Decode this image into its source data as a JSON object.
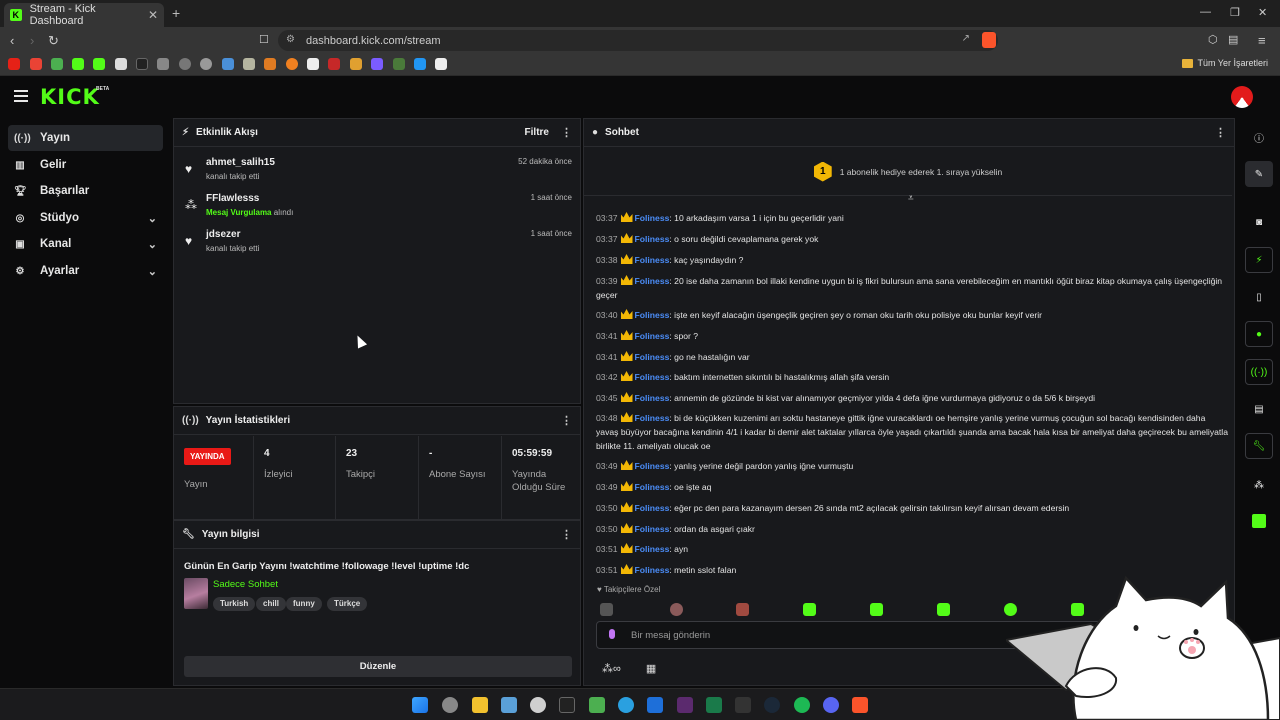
{
  "browser": {
    "tab_title": "Stream - Kick Dashboard",
    "url": "dashboard.kick.com/stream",
    "bookmarks_all": "Tüm Yer İşaretleri"
  },
  "app": {
    "logo": "KICK",
    "beta": "BETA",
    "accent": "#53fc18"
  },
  "sidebar": {
    "items": [
      {
        "label": "Yayın",
        "icon": "broadcast-icon",
        "active": true
      },
      {
        "label": "Gelir",
        "icon": "chart-icon"
      },
      {
        "label": "Başarılar",
        "icon": "trophy-icon"
      },
      {
        "label": "Stüdyo",
        "icon": "studio-icon",
        "expandable": true
      },
      {
        "label": "Kanal",
        "icon": "channel-icon",
        "expandable": true
      },
      {
        "label": "Ayarlar",
        "icon": "gear-icon",
        "expandable": true
      }
    ]
  },
  "activity": {
    "title": "Etkinlik Akışı",
    "filter": "Filtre",
    "events": [
      {
        "name": "ahmet_salih15",
        "sub": "kanalı takip etti",
        "time": "52 dakika önce",
        "icon": "heart-icon"
      },
      {
        "name": "FFlawlesss",
        "sub_highlight": "Mesaj Vurgulama",
        "sub_rest": " alındı",
        "time": "1 saat önce",
        "icon": "kicks-icon"
      },
      {
        "name": "jdsezer",
        "sub": "kanalı takip etti",
        "time": "1 saat önce",
        "icon": "heart-icon"
      }
    ]
  },
  "stats": {
    "title": "Yayın İstatistikleri",
    "live_badge": "YAYINDA",
    "live_label": "Yayın",
    "cells": [
      {
        "value": "4",
        "label": "İzleyici"
      },
      {
        "value": "23",
        "label": "Takipçi"
      },
      {
        "value": "-",
        "label": "Abone Sayısı"
      },
      {
        "value": "05:59:59",
        "label": "Yayında Olduğu Süre"
      }
    ]
  },
  "stream_info": {
    "title": "Yayın bilgisi",
    "stream_title": "Günün En Garip Yayını !watchtime !followage !level !uptime !dc",
    "category": "Sadece Sohbet",
    "tags": [
      "Turkish",
      "chill",
      "funny",
      "Türkçe"
    ],
    "edit": "Düzenle"
  },
  "chat": {
    "title": "Sohbet",
    "promo_num": "1",
    "promo_text": "1 abonelik hediye ederek 1. sıraya yükselin",
    "messages": [
      {
        "time": "03:37",
        "user": "Foliness",
        "text": ": 10 arkadaşım varsa 1 i için bu geçerlidir yani"
      },
      {
        "time": "03:37",
        "user": "Foliness",
        "text": ": o soru değildi cevaplamana gerek yok"
      },
      {
        "time": "03:38",
        "user": "Foliness",
        "text": ": kaç yaşındaydın ?"
      },
      {
        "time": "03:39",
        "user": "Foliness",
        "text": ": 20 ise daha zamanın bol illaki kendine uygun bi iş fikri bulursun ama sana verebileceğim en mantıklı öğüt biraz kitap okumaya çalış üşengeçliğin geçer"
      },
      {
        "time": "03:40",
        "user": "Foliness",
        "text": ": işte en keyif alacağın üşengeçlik geçiren şey o roman oku tarih oku polisiye oku bunlar keyif verir"
      },
      {
        "time": "03:41",
        "user": "Foliness",
        "text": ": spor ?"
      },
      {
        "time": "03:41",
        "user": "Foliness",
        "text": ": go ne hastalığın var"
      },
      {
        "time": "03:42",
        "user": "Foliness",
        "text": ": baktım internetten sıkıntılı bi hastalıkmış allah şifa versin"
      },
      {
        "time": "03:45",
        "user": "Foliness",
        "text": ": annemin de gözünde bi kist var alınamıyor geçmiyor yılda 4 defa iğne vurdurmaya gidiyoruz o da 5/6 k birşeydi"
      },
      {
        "time": "03:48",
        "user": "Foliness",
        "text": ": bi de küçükken kuzenimi arı soktu hastaneye gittik iğne vuracaklardı oe hemşire yanlış yerine vurmuş çocuğun sol bacağı kendisinden daha yavaş büyüyor bacağına kendinin 4/1 i kadar bi demir alet taktalar yıllarca öyle yaşadı çıkartıldı şuanda ama bacak hala kısa bir ameliyat daha geçirecek bu ameliyatla birlikte 11. ameliyatı olucak oe"
      },
      {
        "time": "03:49",
        "user": "Foliness",
        "text": ": yanlış yerine değil pardon yanlış iğne vurmuştu"
      },
      {
        "time": "03:49",
        "user": "Foliness",
        "text": ": oe işte aq"
      },
      {
        "time": "03:50",
        "user": "Foliness",
        "text": ": eğer pc den para kazanayım dersen 26 sında mt2 açılacak gelirsin takılırsın keyif alırsan devam edersin"
      },
      {
        "time": "03:50",
        "user": "Foliness",
        "text": ": ordan da asgari çıakr"
      },
      {
        "time": "03:51",
        "user": "Foliness",
        "text": ": ayn"
      },
      {
        "time": "03:51",
        "user": "Foliness",
        "text": ": metin sslot falan"
      }
    ],
    "followers_only": "Takipçilere Özel",
    "input_placeholder": "Bir mesaj gönderin"
  }
}
